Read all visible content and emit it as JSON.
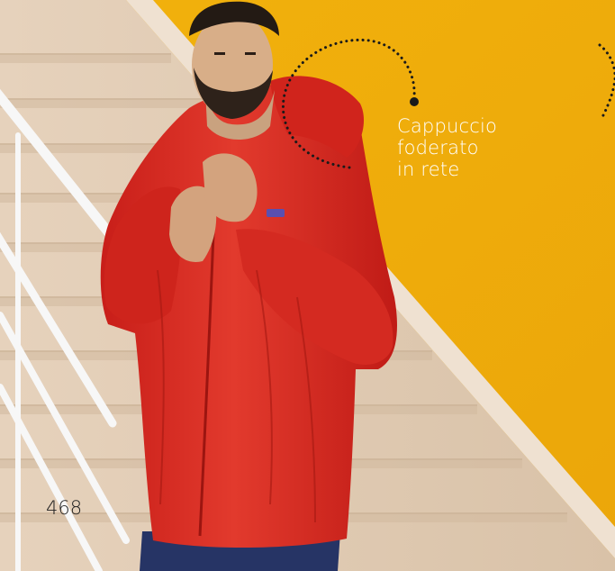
{
  "callout": {
    "lines": [
      "Cappuccio",
      "foderato",
      "in rete"
    ]
  },
  "page_number": "468",
  "colors": {
    "wall": "#F0AE0A",
    "stair": "#E3CDB4",
    "jacket": "#D8271F",
    "pants": "#273566",
    "callout_text": "#FFFFFF"
  }
}
